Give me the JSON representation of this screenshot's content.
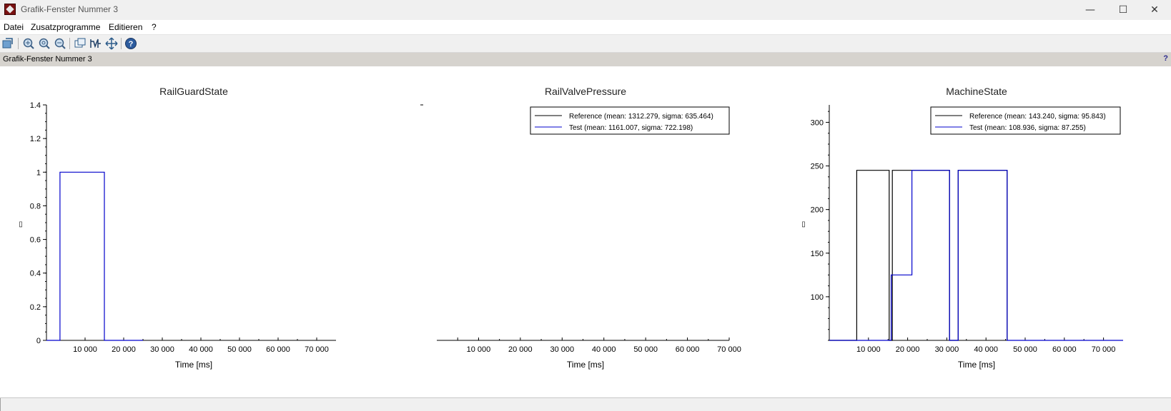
{
  "window": {
    "title": "Grafik-Fenster Nummer 3",
    "minimize_glyph": "—",
    "maximize_glyph": "☐",
    "close_glyph": "✕"
  },
  "menu": {
    "items": [
      "Datei",
      "Zusatzprogramme",
      "Editieren",
      "?"
    ]
  },
  "toolbar": {
    "buttons": [
      {
        "icon": "rotate-icon"
      },
      {
        "icon": "zoom-icon"
      },
      {
        "icon": "zoom-in-icon"
      },
      {
        "icon": "zoom-out-icon"
      },
      {
        "icon": "datatip-icon"
      },
      {
        "icon": "edit-curve-icon"
      },
      {
        "icon": "pan-icon"
      },
      {
        "icon": "help-icon"
      }
    ]
  },
  "infobar": {
    "label": "Grafik-Fenster Nummer 3",
    "help": "?"
  },
  "colors": {
    "reference": "#000000",
    "test": "#0000cc"
  },
  "chart_data": [
    {
      "type": "line",
      "title": "RailGuardState",
      "xlabel": "Time [ms]",
      "ylabel": "▯",
      "xlim": [
        0,
        75000
      ],
      "ylim": [
        0,
        1.4
      ],
      "x_ticks": [
        10000,
        20000,
        30000,
        40000,
        50000,
        60000,
        70000
      ],
      "x_tick_labels": [
        "10 000",
        "20 000",
        "30 000",
        "40 000",
        "50 000",
        "60 000",
        "70 000"
      ],
      "y_ticks": [
        0,
        0.2,
        0.4,
        0.6,
        0.8,
        1,
        1.2,
        1.4
      ],
      "y_tick_labels": [
        "0",
        "0.2",
        "0.4",
        "0.6",
        "0.8",
        "1",
        "1.2",
        "1.4"
      ],
      "legend": null,
      "series": [
        {
          "color": "#0000cc",
          "x": [
            0,
            3500,
            3500,
            15000,
            15000,
            25000
          ],
          "y": [
            0,
            0,
            1,
            1,
            0,
            0
          ]
        }
      ]
    },
    {
      "type": "line",
      "title": "RailValvePressure",
      "xlabel": "Time [ms]",
      "ylabel": "-",
      "xlim": [
        0,
        70000
      ],
      "ylim": [
        0,
        1
      ],
      "x_ticks": [
        5000,
        10000,
        20000,
        30000,
        40000,
        50000,
        60000,
        70000
      ],
      "x_tick_labels": [
        "",
        "10 000",
        "20 000",
        "30 000",
        "40 000",
        "50 000",
        "60 000",
        "70 000"
      ],
      "y_ticks": [],
      "y_tick_labels": [],
      "legend": {
        "position": "top-right",
        "entries": [
          {
            "label": "Reference (mean: 1312.279, sigma: 635.464)",
            "color": "#000000"
          },
          {
            "label": "Test (mean: 1161.007, sigma: 722.198)",
            "color": "#0000cc"
          }
        ]
      },
      "series": []
    },
    {
      "type": "line",
      "title": "MachineState",
      "xlabel": "Time [ms]",
      "ylabel": "▯",
      "xlim": [
        0,
        75000
      ],
      "ylim": [
        50,
        320
      ],
      "x_ticks": [
        10000,
        20000,
        30000,
        40000,
        50000,
        60000,
        70000
      ],
      "x_tick_labels": [
        "10 000",
        "20 000",
        "30 000",
        "40 000",
        "50 000",
        "60 000",
        "70 000"
      ],
      "y_ticks": [
        100,
        150,
        200,
        250,
        300
      ],
      "y_tick_labels": [
        "100",
        "150",
        "200",
        "250",
        "300"
      ],
      "legend": {
        "position": "top-right",
        "entries": [
          {
            "label": "Reference (mean: 143.240, sigma: 95.843)",
            "color": "#000000"
          },
          {
            "label": "Test (mean: 108.936, sigma: 87.255)",
            "color": "#0000cc"
          }
        ]
      },
      "series": [
        {
          "name": "Reference",
          "color": "#000000",
          "x": [
            0,
            7000,
            7000,
            15300,
            15300,
            16100,
            16100,
            30700,
            30700,
            32900,
            32900,
            45400,
            45400
          ],
          "y": [
            50,
            50,
            245,
            245,
            50,
            50,
            245,
            245,
            50,
            50,
            245,
            245,
            50
          ]
        },
        {
          "name": "Test",
          "color": "#0000cc",
          "x": [
            0,
            15800,
            15800,
            21100,
            21100,
            30700,
            30700,
            32900,
            32900,
            45400,
            45400,
            75000
          ],
          "y": [
            50,
            50,
            125,
            125,
            245,
            245,
            50,
            50,
            245,
            245,
            50,
            50
          ]
        }
      ]
    }
  ]
}
